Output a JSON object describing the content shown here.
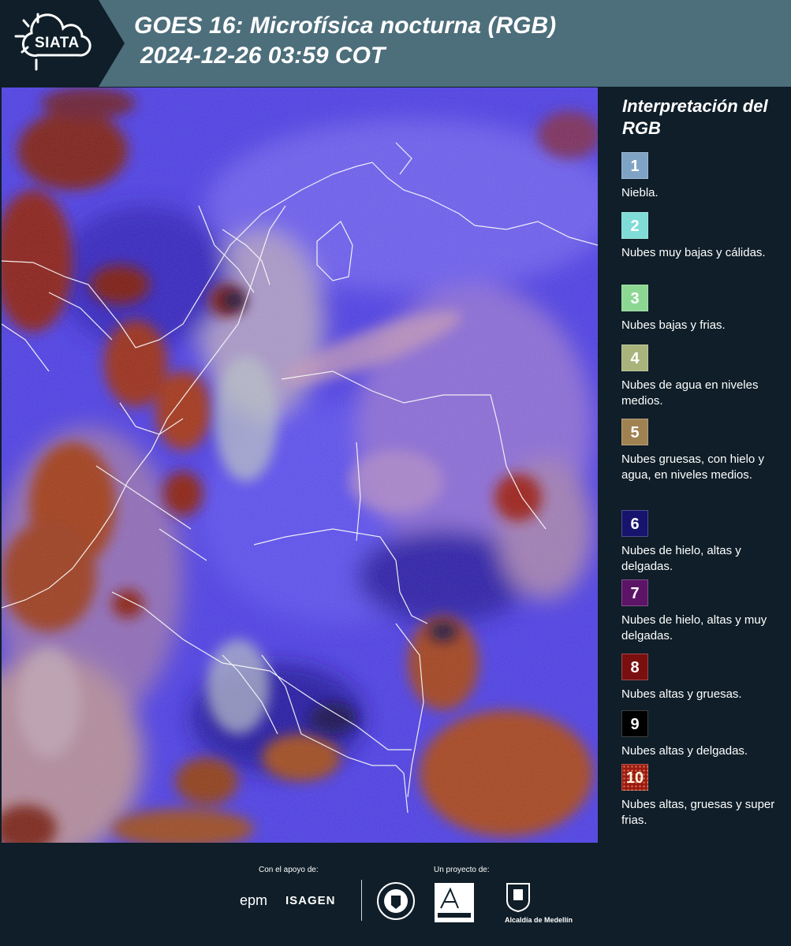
{
  "header": {
    "logo_text": "SIATA",
    "title_line1": "GOES 16: Microfísica nocturna (RGB)",
    "title_line2": "2024-12-26 03:59 COT"
  },
  "legend": {
    "title": "Interpretación del RGB",
    "items": [
      {
        "number": "1",
        "label": "Niebla.",
        "color": "#7fa3c4"
      },
      {
        "number": "2",
        "label": "Nubes muy bajas y cálidas.",
        "color": "#7fdcd6"
      },
      {
        "number": "3",
        "label": "Nubes bajas y frias.",
        "color": "#8cd893"
      },
      {
        "number": "4",
        "label": "Nubes de agua en niveles medios.",
        "color": "#a9b47c"
      },
      {
        "number": "5",
        "label": "Nubes gruesas, con hielo y agua, en niveles medios.",
        "color": "#a08252"
      },
      {
        "number": "6",
        "label": "Nubes de hielo, altas y delgadas.",
        "color": "#17146e"
      },
      {
        "number": "7",
        "label": "Nubes de hielo, altas y muy delgadas.",
        "color": "#5c1467"
      },
      {
        "number": "8",
        "label": "Nubes altas y gruesas.",
        "color": "#7a0f0f"
      },
      {
        "number": "9",
        "label": "Nubes altas y delgadas.",
        "color": "#000000"
      },
      {
        "number": "10",
        "label": "Nubes altas, gruesas y super frias.",
        "color": "#9b1a12"
      }
    ]
  },
  "footer": {
    "support_label": "Con el apoyo de:",
    "epm": "epm",
    "isagen": "ISAGEN",
    "project_label": "Un proyecto de:",
    "alcaldia": "Alcaldía de Medellín"
  },
  "map": {
    "description_icon": "satellite-rgb-image"
  }
}
